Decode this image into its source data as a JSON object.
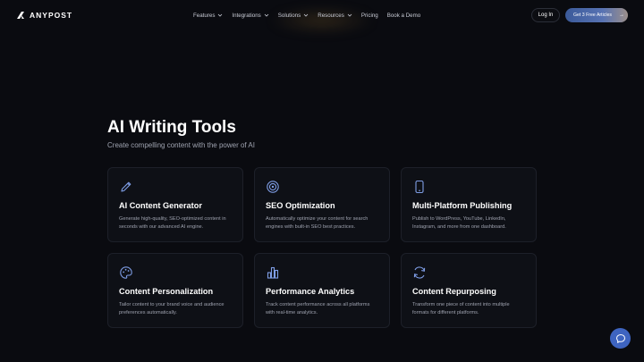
{
  "nav": {
    "logo_text": "ANYPOST",
    "menu": [
      {
        "label": "Features",
        "has_dropdown": true
      },
      {
        "label": "Integrations",
        "has_dropdown": true
      },
      {
        "label": "Solutions",
        "has_dropdown": true
      },
      {
        "label": "Resources",
        "has_dropdown": true
      },
      {
        "label": "Pricing",
        "has_dropdown": false
      },
      {
        "label": "Book a Demo",
        "has_dropdown": false
      }
    ],
    "login_label": "Log In",
    "cta_label": "Get 3 Free Articles",
    "cta_arrow": "→"
  },
  "hero": {
    "title": "AI Writing Tools",
    "subtitle": "Create compelling content with the power of AI"
  },
  "features": [
    {
      "icon": "pencil-icon",
      "title": "AI Content Generator",
      "desc": "Generate high-quality, SEO-optimized content in seconds with our advanced AI engine."
    },
    {
      "icon": "target-icon",
      "title": "SEO Optimization",
      "desc": "Automatically optimize your content for search engines with built-in SEO best practices."
    },
    {
      "icon": "mobile-icon",
      "title": "Multi-Platform Publishing",
      "desc": "Publish to WordPress, YouTube, LinkedIn, Instagram, and more from one dashboard."
    },
    {
      "icon": "palette-icon",
      "title": "Content Personalization",
      "desc": "Tailor content to your brand voice and audience preferences automatically."
    },
    {
      "icon": "bar-chart-icon",
      "title": "Performance Analytics",
      "desc": "Track content performance across all platforms with real-time analytics."
    },
    {
      "icon": "refresh-icon",
      "title": "Content Repurposing",
      "desc": "Transform one piece of content into multiple formats for different platforms."
    }
  ],
  "help": {
    "icon": "chat-bubble-icon"
  },
  "colors": {
    "background": "#0a0b10",
    "card": "#0e1016",
    "accent": "#7f9ee6",
    "help_button": "#3e64c0"
  }
}
